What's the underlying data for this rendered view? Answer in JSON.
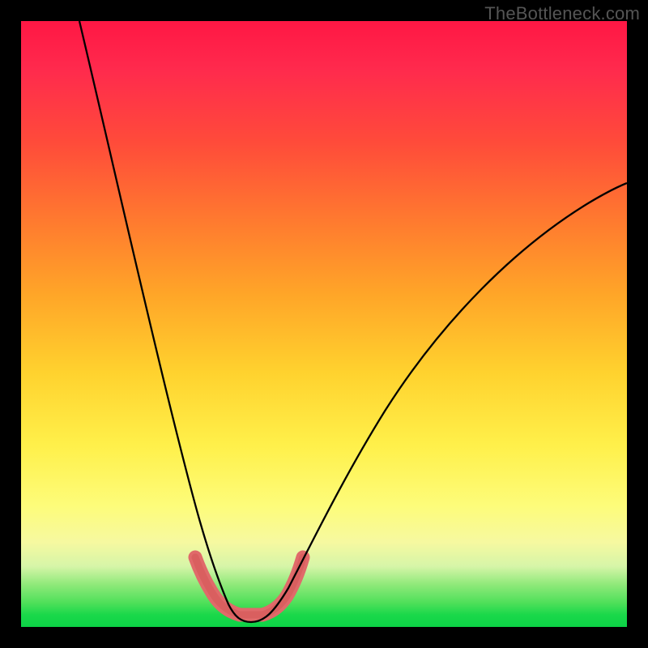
{
  "watermark": "TheBottleneck.com",
  "chart_data": {
    "type": "line",
    "title": "",
    "xlabel": "",
    "ylabel": "",
    "xlim": [
      0,
      100
    ],
    "ylim": [
      0,
      100
    ],
    "grid": false,
    "legend": false,
    "series": [
      {
        "name": "left-arm",
        "x": [
          10,
          12,
          14,
          16,
          18,
          20,
          22,
          24,
          26,
          27.5,
          29,
          30.5,
          32,
          33,
          34
        ],
        "values": [
          100,
          90,
          80,
          70,
          60,
          50,
          41,
          32,
          23,
          17,
          12,
          8,
          5,
          3,
          2
        ]
      },
      {
        "name": "right-arm",
        "x": [
          40,
          42,
          45,
          48,
          52,
          57,
          63,
          70,
          78,
          87,
          97,
          100
        ],
        "values": [
          2,
          4,
          8,
          13,
          20,
          28,
          37,
          46,
          55,
          63,
          70,
          72
        ]
      },
      {
        "name": "floor-band",
        "x": [
          30,
          32,
          34,
          36,
          38,
          40,
          42,
          44
        ],
        "values": [
          11,
          6,
          3,
          2,
          2,
          3,
          6,
          11
        ]
      }
    ],
    "colors": {
      "curve": "#000000",
      "band": "#e06a6a"
    }
  }
}
